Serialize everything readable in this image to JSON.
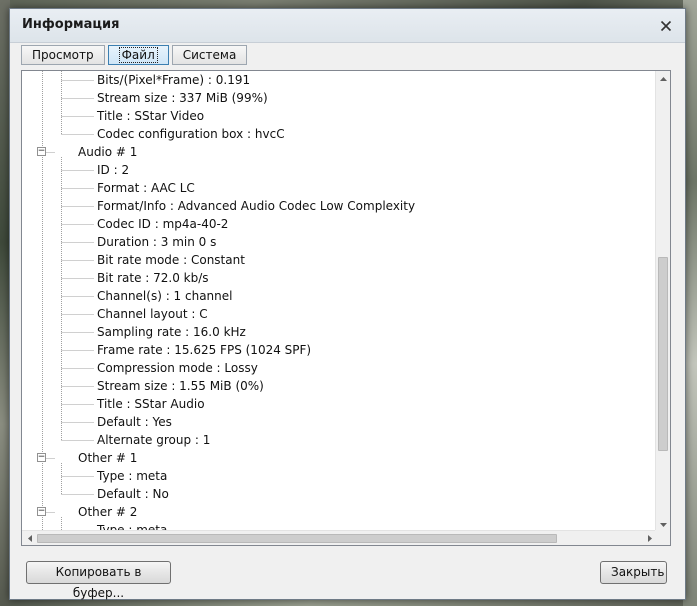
{
  "window": {
    "title": "Информация"
  },
  "tabs": [
    {
      "label": "Просмотр",
      "active": false
    },
    {
      "label": "Файл",
      "active": true
    },
    {
      "label": "Система",
      "active": false
    }
  ],
  "tree": {
    "rows": [
      {
        "text": "Bits/(Pixel*Frame) : 0.191",
        "level": 2
      },
      {
        "text": "Stream size : 337 MiB (99%)",
        "level": 2
      },
      {
        "text": "Title : SStar Video",
        "level": 2
      },
      {
        "text": "Codec configuration box : hvcC",
        "level": 2
      },
      {
        "text": "Audio # 1",
        "level": 1,
        "expander": "−"
      },
      {
        "text": "ID : 2",
        "level": 2
      },
      {
        "text": "Format : AAC LC",
        "level": 2
      },
      {
        "text": "Format/Info : Advanced Audio Codec Low Complexity",
        "level": 2
      },
      {
        "text": "Codec ID : mp4a-40-2",
        "level": 2
      },
      {
        "text": "Duration : 3 min 0 s",
        "level": 2
      },
      {
        "text": "Bit rate mode : Constant",
        "level": 2
      },
      {
        "text": "Bit rate : 72.0 kb/s",
        "level": 2
      },
      {
        "text": "Channel(s) : 1 channel",
        "level": 2
      },
      {
        "text": "Channel layout : C",
        "level": 2
      },
      {
        "text": "Sampling rate : 16.0 kHz",
        "level": 2
      },
      {
        "text": "Frame rate : 15.625 FPS (1024 SPF)",
        "level": 2
      },
      {
        "text": "Compression mode : Lossy",
        "level": 2
      },
      {
        "text": "Stream size : 1.55 MiB (0%)",
        "level": 2
      },
      {
        "text": "Title : SStar Audio",
        "level": 2
      },
      {
        "text": "Default : Yes",
        "level": 2
      },
      {
        "text": "Alternate group : 1",
        "level": 2
      },
      {
        "text": "Other # 1",
        "level": 1,
        "expander": "−"
      },
      {
        "text": "Type : meta",
        "level": 2
      },
      {
        "text": "Default : No",
        "level": 2
      },
      {
        "text": "Other # 2",
        "level": 1,
        "expander": "−"
      },
      {
        "text": "Type : meta",
        "level": 2
      }
    ]
  },
  "scroll": {
    "vertical_position": 0.72,
    "vertical_visible": 0.45,
    "horizontal_position": 0.0,
    "horizontal_visible": 0.86
  },
  "buttons": {
    "copy_label": "Копировать в буфер...",
    "close_label": "Закрыть"
  },
  "colors": {
    "accent": "#3c7fb1",
    "tree_line": "#a0a0a0"
  },
  "icons": {
    "close": "close-icon",
    "expander": "minus-box-icon"
  }
}
